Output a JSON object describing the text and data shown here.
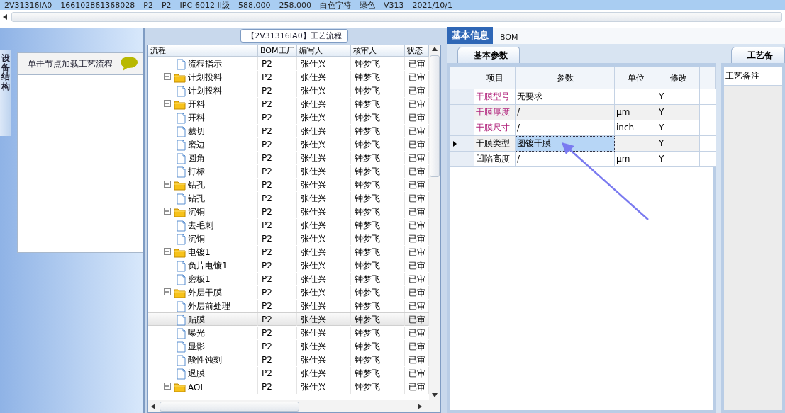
{
  "top_record": {
    "cells": [
      "2V31316IA0",
      "166102861368028",
      "P2",
      "P2",
      "IPC-6012 II级",
      "588.000",
      "258.000",
      "白色字符",
      "绿色",
      "V313",
      "2021/10/1"
    ]
  },
  "left_panel": {
    "side_tab": "设备结构",
    "hint": "单击节点加载工艺流程"
  },
  "process_panel": {
    "title": "【2V31316IA0】工艺流程",
    "columns": [
      "流程",
      "BOM工厂",
      "编写人",
      "核审人",
      "状态"
    ],
    "tree": [
      {
        "label": "流程指示",
        "kind": "document",
        "selected": false,
        "cells": [
          "P2",
          "张仕兴",
          "钟梦飞",
          "已审"
        ]
      },
      {
        "label": "计划投料",
        "kind": "folder",
        "expanded": true,
        "selected": false,
        "cells": [
          "P2",
          "张仕兴",
          "钟梦飞",
          "已审"
        ],
        "children": [
          {
            "label": "计划投料",
            "kind": "document",
            "selected": false,
            "cells": [
              "P2",
              "张仕兴",
              "钟梦飞",
              "已审"
            ]
          }
        ]
      },
      {
        "label": "开料",
        "kind": "folder",
        "expanded": true,
        "selected": false,
        "cells": [
          "P2",
          "张仕兴",
          "钟梦飞",
          "已审"
        ],
        "children": [
          {
            "label": "开料",
            "kind": "document",
            "selected": false,
            "cells": [
              "P2",
              "张仕兴",
              "钟梦飞",
              "已审"
            ]
          },
          {
            "label": "裁切",
            "kind": "document",
            "selected": false,
            "cells": [
              "P2",
              "张仕兴",
              "钟梦飞",
              "已审"
            ]
          },
          {
            "label": "磨边",
            "kind": "document",
            "selected": false,
            "cells": [
              "P2",
              "张仕兴",
              "钟梦飞",
              "已审"
            ]
          },
          {
            "label": "圆角",
            "kind": "document",
            "selected": false,
            "cells": [
              "P2",
              "张仕兴",
              "钟梦飞",
              "已审"
            ]
          },
          {
            "label": "打标",
            "kind": "document",
            "selected": false,
            "cells": [
              "P2",
              "张仕兴",
              "钟梦飞",
              "已审"
            ]
          }
        ]
      },
      {
        "label": "钻孔",
        "kind": "folder",
        "expanded": true,
        "selected": false,
        "cells": [
          "P2",
          "张仕兴",
          "钟梦飞",
          "已审"
        ],
        "children": [
          {
            "label": "钻孔",
            "kind": "document",
            "selected": false,
            "cells": [
              "P2",
              "张仕兴",
              "钟梦飞",
              "已审"
            ]
          }
        ]
      },
      {
        "label": "沉铜",
        "kind": "folder",
        "expanded": true,
        "selected": false,
        "cells": [
          "P2",
          "张仕兴",
          "钟梦飞",
          "已审"
        ],
        "children": [
          {
            "label": "去毛刺",
            "kind": "document",
            "selected": false,
            "cells": [
              "P2",
              "张仕兴",
              "钟梦飞",
              "已审"
            ]
          },
          {
            "label": "沉铜",
            "kind": "document",
            "selected": false,
            "cells": [
              "P2",
              "张仕兴",
              "钟梦飞",
              "已审"
            ]
          }
        ]
      },
      {
        "label": "电镀1",
        "kind": "folder",
        "expanded": true,
        "selected": false,
        "cells": [
          "P2",
          "张仕兴",
          "钟梦飞",
          "已审"
        ],
        "children": [
          {
            "label": "负片电镀1",
            "kind": "document",
            "selected": false,
            "cells": [
              "P2",
              "张仕兴",
              "钟梦飞",
              "已审"
            ]
          },
          {
            "label": "磨板1",
            "kind": "document",
            "selected": false,
            "cells": [
              "P2",
              "张仕兴",
              "钟梦飞",
              "已审"
            ]
          }
        ]
      },
      {
        "label": "外层干膜",
        "kind": "folder",
        "expanded": true,
        "selected": false,
        "cells": [
          "P2",
          "张仕兴",
          "钟梦飞",
          "已审"
        ],
        "children": [
          {
            "label": "外层前处理",
            "kind": "document",
            "selected": false,
            "cells": [
              "P2",
              "张仕兴",
              "钟梦飞",
              "已审"
            ]
          },
          {
            "label": "贴膜",
            "kind": "document",
            "selected": true,
            "cells": [
              "P2",
              "张仕兴",
              "钟梦飞",
              "已审"
            ]
          },
          {
            "label": "曝光",
            "kind": "document",
            "selected": false,
            "cells": [
              "P2",
              "张仕兴",
              "钟梦飞",
              "已审"
            ]
          },
          {
            "label": "显影",
            "kind": "document",
            "selected": false,
            "cells": [
              "P2",
              "张仕兴",
              "钟梦飞",
              "已审"
            ]
          },
          {
            "label": "酸性蚀刻",
            "kind": "document",
            "selected": false,
            "cells": [
              "P2",
              "张仕兴",
              "钟梦飞",
              "已审"
            ]
          },
          {
            "label": "退膜",
            "kind": "document",
            "selected": false,
            "cells": [
              "P2",
              "张仕兴",
              "钟梦飞",
              "已审"
            ]
          }
        ]
      },
      {
        "label": "AOI",
        "kind": "folder",
        "expanded": true,
        "selected": false,
        "cells": [
          "P2",
          "张仕兴",
          "钟梦飞",
          "已审"
        ]
      }
    ]
  },
  "detail_tabs": [
    {
      "label": "基本信息",
      "selected": true
    },
    {
      "label": "BOM",
      "selected": false
    }
  ],
  "params_panel": {
    "tab": "基本参数",
    "columns": [
      "项目",
      "参数",
      "单位",
      "修改"
    ],
    "rows": [
      {
        "item": "干膜型号",
        "required": true,
        "value": "无要求",
        "unit": "",
        "modify": "Y",
        "selected": false
      },
      {
        "item": "干膜厚度",
        "required": true,
        "value": "/",
        "unit": "μm",
        "modify": "Y",
        "selected": false
      },
      {
        "item": "干膜尺寸",
        "required": true,
        "value": "/",
        "unit": "inch",
        "modify": "Y",
        "selected": false
      },
      {
        "item": "干膜类型",
        "required": false,
        "value": "图镀干膜",
        "unit": "",
        "modify": "Y",
        "selected": true
      },
      {
        "item": "凹陷高度",
        "required": false,
        "value": "/",
        "unit": "μm",
        "modify": "Y",
        "selected": false
      }
    ]
  },
  "notes_panel": {
    "tab": "工艺备",
    "label": "工艺备注"
  }
}
